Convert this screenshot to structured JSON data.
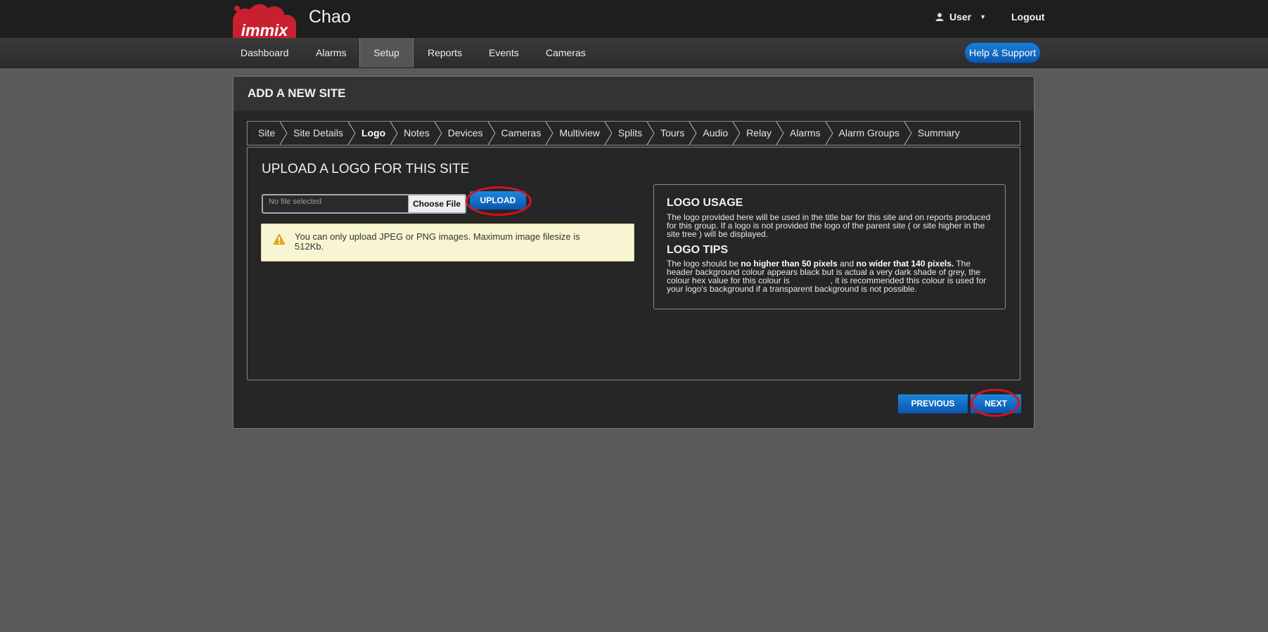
{
  "header": {
    "brand": "immix",
    "site_name": "Chao",
    "user_label": "User",
    "logout_label": "Logout"
  },
  "nav": {
    "items": [
      "Dashboard",
      "Alarms",
      "Setup",
      "Reports",
      "Events",
      "Cameras"
    ],
    "active": "Setup",
    "help_label": "Help & Support"
  },
  "panel": {
    "title": "ADD A NEW SITE",
    "steps": [
      "Site",
      "Site Details",
      "Logo",
      "Notes",
      "Devices",
      "Cameras",
      "Multiview",
      "Splits",
      "Tours",
      "Audio",
      "Relay",
      "Alarms",
      "Alarm Groups",
      "Summary"
    ],
    "current_step": "Logo",
    "section_title": "UPLOAD A LOGO FOR THIS SITE",
    "file_placeholder": "No file selected",
    "choose_file_label": "Choose File",
    "upload_label": "UPLOAD",
    "warning": "You can only upload JPEG or PNG images. Maximum image filesize is 512Kb.",
    "previous_label": "PREVIOUS",
    "next_label": "NEXT"
  },
  "info": {
    "usage_title": "LOGO USAGE",
    "usage_text": "The logo provided here will be used in the title bar for this site and on reports produced for this group. If a logo is not provided the logo of the parent site ( or site higher in the site tree ) will be displayed.",
    "tips_title": "LOGO TIPS",
    "tips_prefix": "The logo should be ",
    "tips_bold_1": "no higher than 50 pixels",
    "tips_mid": " and ",
    "tips_bold_2": "no wider that 140 pixels.",
    "tips_text": " The header background colour appears black but is actual a very dark shade of grey, the colour hex value for this colour is",
    "tips_text_2": ", it is recommended this colour is used for your logo's background if a transparent background is not possible."
  },
  "colors": {
    "accent_blue": "#0a56ad",
    "highlight_ring": "#d9111a",
    "brand_red": "#c8202f"
  }
}
